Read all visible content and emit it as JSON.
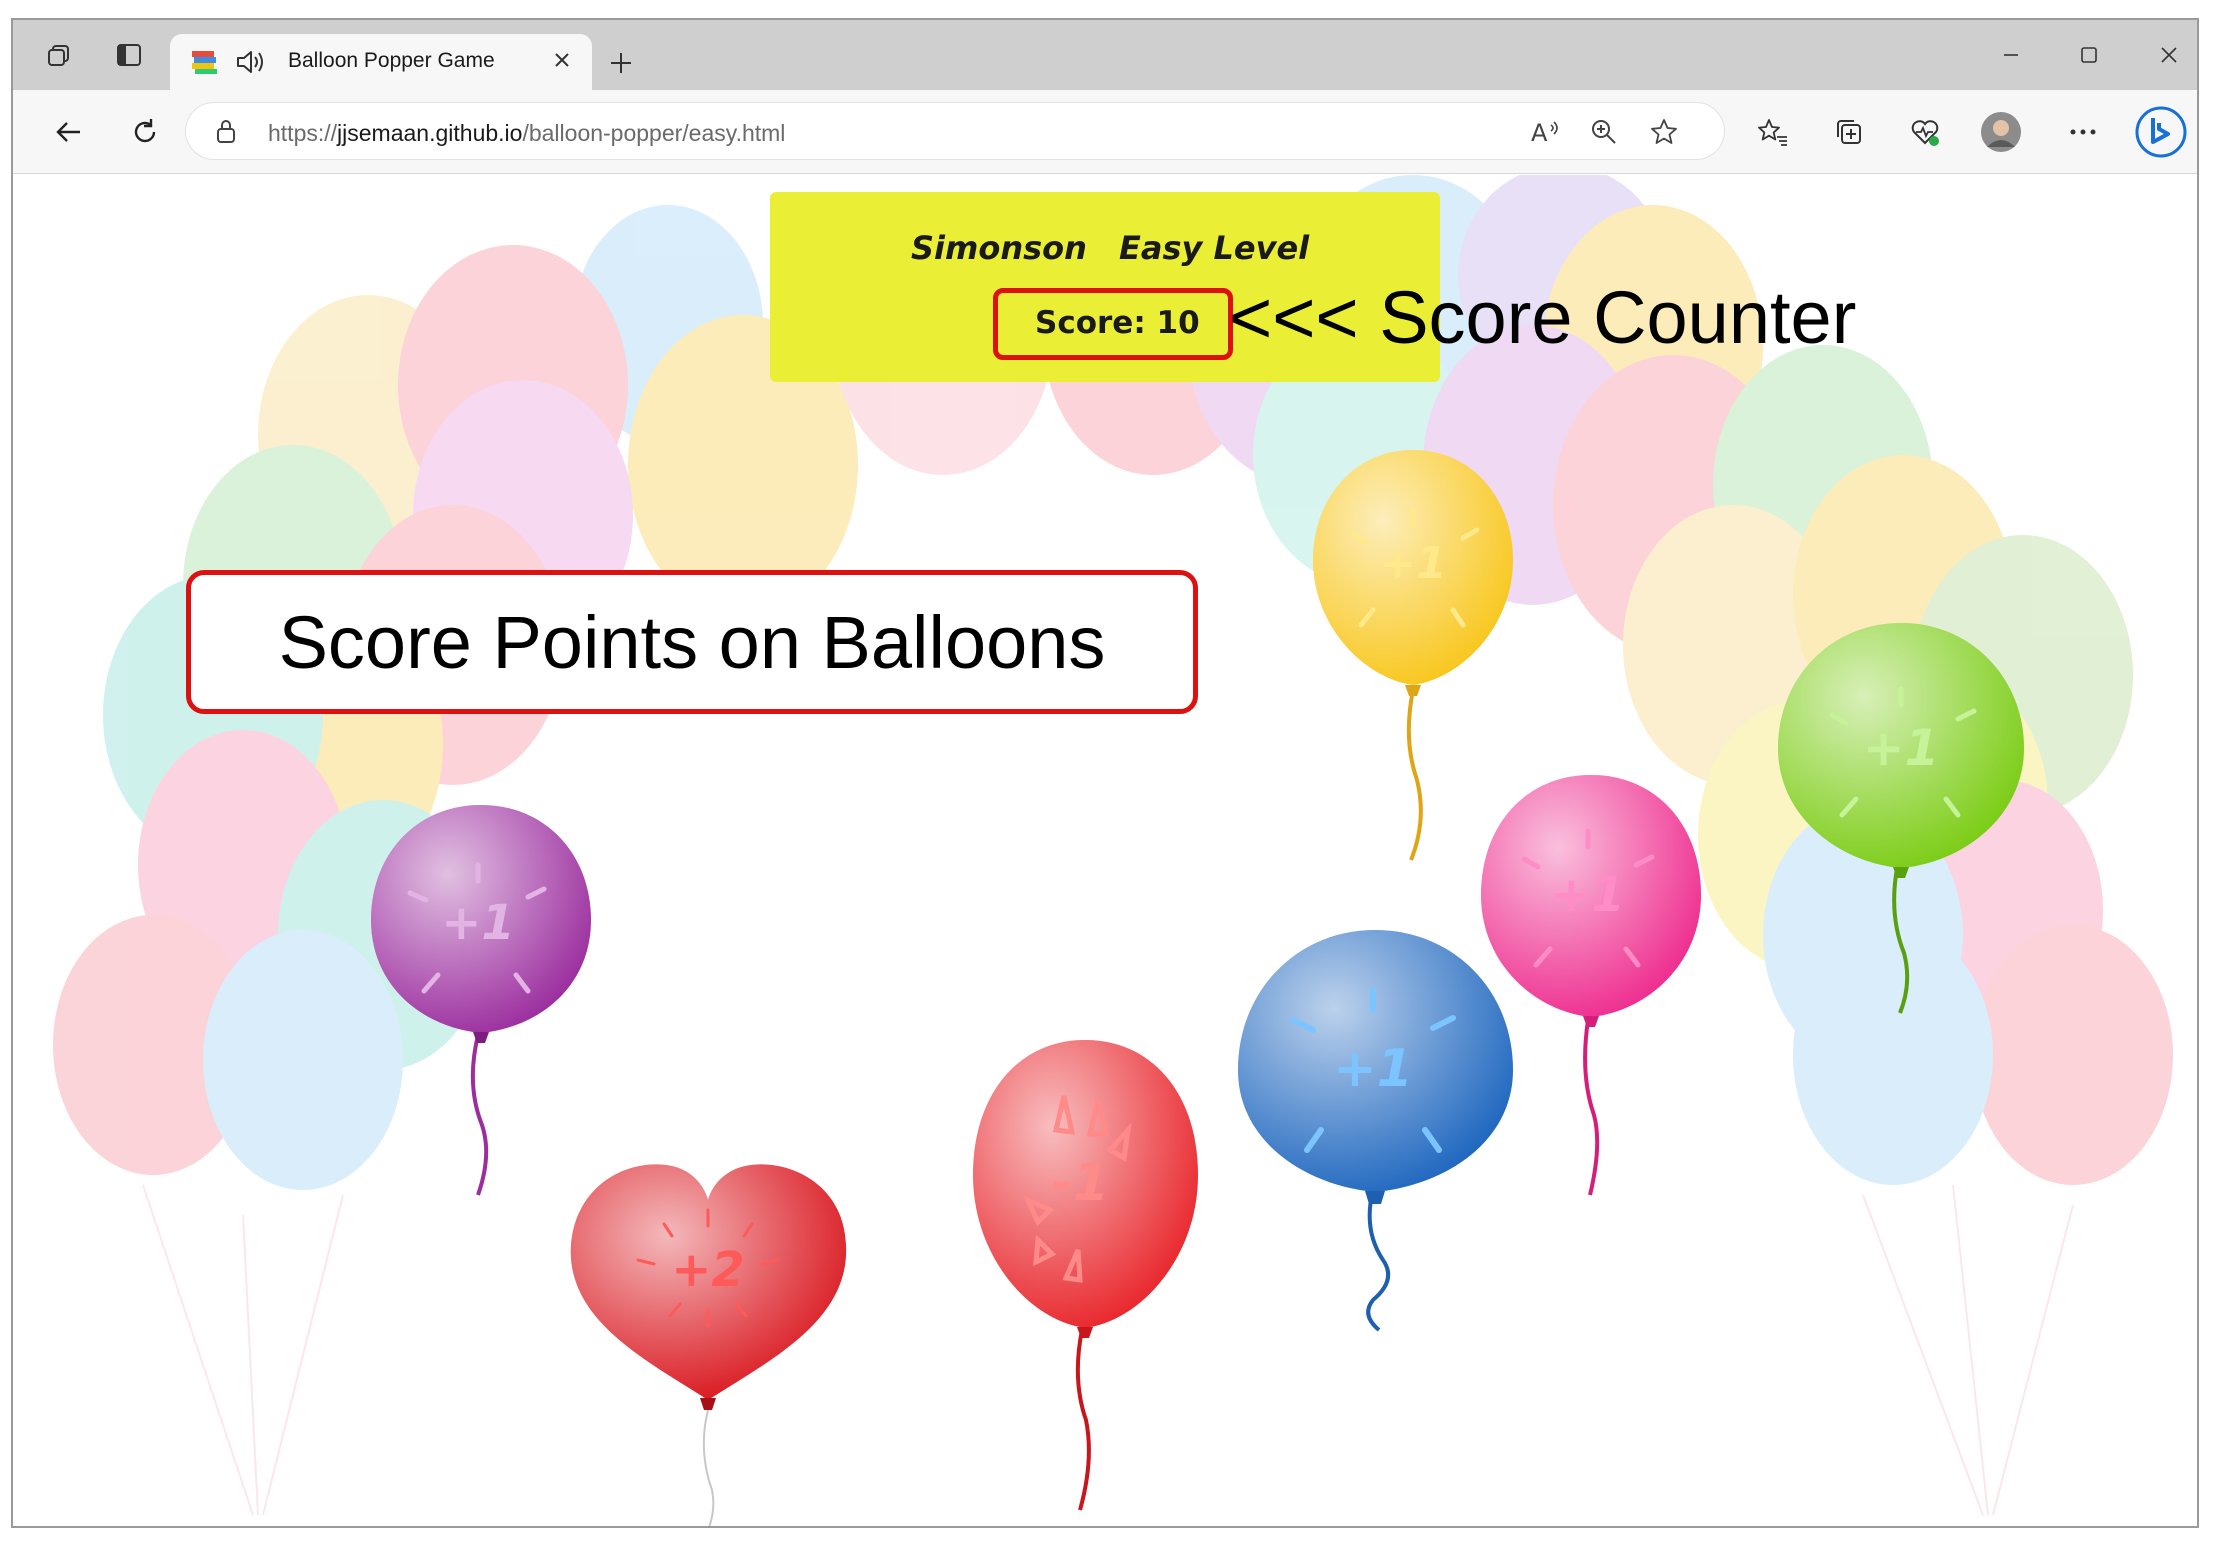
{
  "browser": {
    "tab_title": "Balloon Popper Game",
    "url_prefix": "https://",
    "url_host": "jjsemaan.github.io",
    "url_path": "/balloon-popper/easy.html",
    "icons": [
      "workspaces-icon",
      "tab-actions-icon",
      "favicon-icon",
      "speaker-icon",
      "close-tab-icon",
      "new-tab-icon",
      "minimize-icon",
      "maximize-icon",
      "close-window-icon",
      "back-icon",
      "refresh-icon",
      "lock-icon",
      "read-aloud-icon",
      "zoom-icon",
      "favorite-star-icon",
      "favorites-icon",
      "collections-icon",
      "browser-health-icon",
      "profile-avatar",
      "more-icon",
      "bing-copilot-icon"
    ]
  },
  "game": {
    "player_name": "Simonson",
    "level": "Easy Level",
    "score_text": "Score: 10",
    "panel_color": "#eaee34",
    "balloons": [
      {
        "name": "yellow",
        "label": "+1",
        "color": "#f6c51a"
      },
      {
        "name": "green",
        "label": "+1",
        "color": "#7bcc14"
      },
      {
        "name": "purple",
        "label": "+1",
        "color": "#9b2d9e"
      },
      {
        "name": "pink",
        "label": "+1",
        "color": "#ee2c8e"
      },
      {
        "name": "blue",
        "label": "+1",
        "color": "#1f67bf"
      },
      {
        "name": "red",
        "label": "-1",
        "color": "#e8242a"
      },
      {
        "name": "heart",
        "label": "+2",
        "color": "#d9141c"
      }
    ]
  },
  "annotations": {
    "score_counter": "<<< Score Counter",
    "score_points": "Score Points on Balloons",
    "highlight_color": "#dd1111"
  }
}
